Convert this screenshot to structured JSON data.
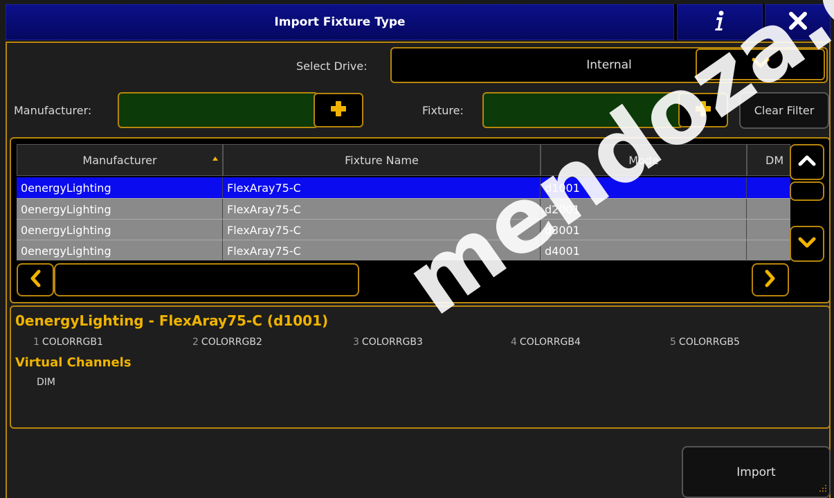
{
  "dialog": {
    "title": "Import Fixture Type",
    "info_icon": "info-icon",
    "close_icon": "close-icon"
  },
  "drive": {
    "label": "Select Drive:",
    "value": "Internal"
  },
  "filters": {
    "manufacturer_label": "Manufacturer:",
    "manufacturer_value": "",
    "fixture_label": "Fixture:",
    "fixture_value": "",
    "clear_label": "Clear Filter"
  },
  "table": {
    "columns": [
      "Manufacturer",
      "Fixture Name",
      "Mode",
      "DM"
    ],
    "rows": [
      {
        "manufacturer": "0energyLighting",
        "fixture": "FlexAray75-C",
        "mode": "d1001",
        "selected": true
      },
      {
        "manufacturer": "0energyLighting",
        "fixture": "FlexAray75-C",
        "mode": "d2001",
        "selected": false
      },
      {
        "manufacturer": "0energyLighting",
        "fixture": "FlexAray75-C",
        "mode": "d3001",
        "selected": false
      },
      {
        "manufacturer": "0energyLighting",
        "fixture": "FlexAray75-C",
        "mode": "d4001",
        "selected": false
      }
    ]
  },
  "details": {
    "title": "0energyLighting - FlexAray75-C (d1001)",
    "channels": [
      {
        "num": "1",
        "name": "COLORRGB1"
      },
      {
        "num": "2",
        "name": "COLORRGB2"
      },
      {
        "num": "3",
        "name": "COLORRGB3"
      },
      {
        "num": "4",
        "name": "COLORRGB4"
      },
      {
        "num": "5",
        "name": "COLORRGB5"
      }
    ],
    "virtual_title": "Virtual Channels",
    "virtual_items": [
      "DIM"
    ]
  },
  "actions": {
    "import_label": "Import"
  },
  "watermark": "mendoza.com.mx",
  "colors": {
    "accent": "#b8860b",
    "title_bar": "#0b108a",
    "selected_row": "#0b0bf0",
    "details_title": "#f0b400",
    "filter_field": "#0c3a08"
  }
}
